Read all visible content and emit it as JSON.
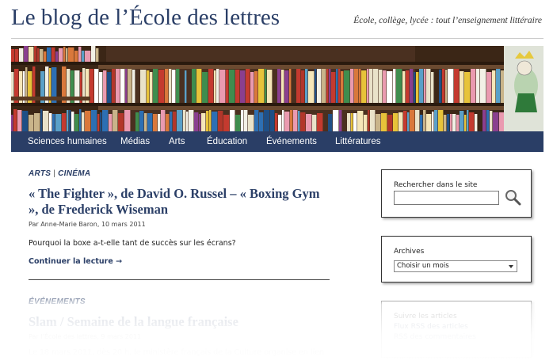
{
  "site": {
    "title": "Le blog de l’École des lettres",
    "tagline": "École, collège, lycée : tout l’enseignement littéraire"
  },
  "nav": {
    "items": [
      "Sciences humaines",
      "Médias",
      "Arts",
      "Éducation",
      "Événements",
      "Littératures"
    ]
  },
  "posts": [
    {
      "categories": [
        "ARTS",
        "CINÉMA"
      ],
      "category_separator": "|",
      "title": "« The Fighter », de David O. Russel – « Boxing Gym », de Frederick Wiseman",
      "byline": "Par Anne-Marie Baron, 10 mars 2011",
      "excerpt": "Pourquoi la boxe a-t-elle tant de succès sur les écrans?",
      "more": "Continuer la lecture →"
    },
    {
      "categories": [
        "ÉVÉNEMENTS"
      ],
      "title": "Slam / Semaine de la langue française",
      "byline": "Par l’École des lettres, 9 mars 2011",
      "excerpt": "Le 18 mars 2011, dès 20 h, le ministère français de la Culture organise en lien"
    }
  ],
  "sidebar": {
    "search": {
      "label": "Rechercher dans le site",
      "value": ""
    },
    "archives": {
      "label": "Archives",
      "selected": "Choisir un mois"
    },
    "follow": {
      "label": "Suivre les articles",
      "links": [
        "Flux RSS des articles",
        "RSS des commentaires"
      ]
    }
  },
  "colors": {
    "brand": "#2b3f67",
    "nav_bg": "#2a3e66"
  }
}
